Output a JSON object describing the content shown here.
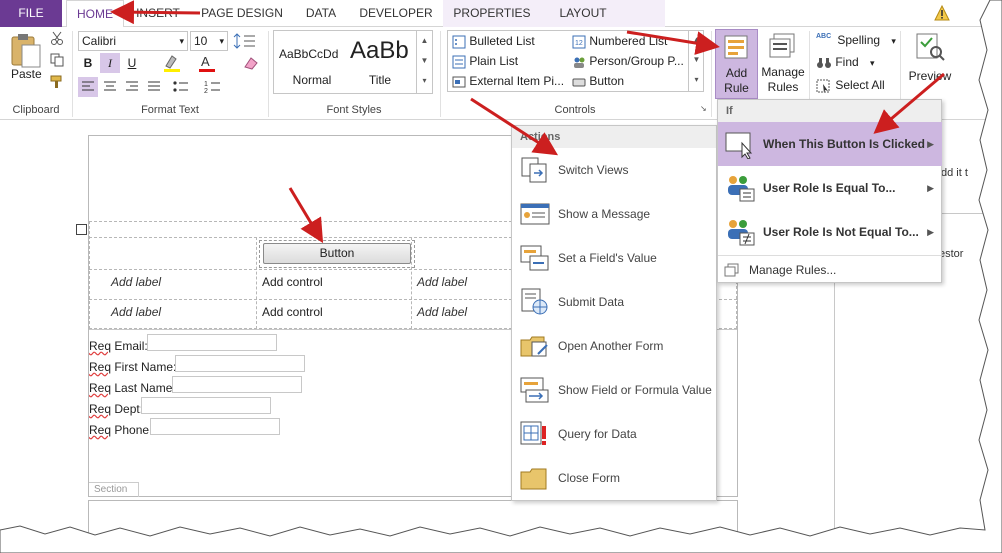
{
  "tabs": {
    "file": "FILE",
    "home": "HOME",
    "insert": "INSERT",
    "page_design": "PAGE DESIGN",
    "data": "DATA",
    "developer": "DEVELOPER",
    "properties": "PROPERTIES",
    "layout": "LAYOUT"
  },
  "clipboard": {
    "paste": "Paste",
    "group_label": "Clipboard"
  },
  "format_text": {
    "font_name": "Calibri",
    "font_size": "10",
    "bold": "B",
    "italic": "I",
    "underline": "U",
    "group_label": "Format Text"
  },
  "font_styles": {
    "normal_sample": "AaBbCcDd",
    "normal_name": "Normal",
    "title_sample": "AaBb",
    "title_name": "Title",
    "group_label": "Font Styles"
  },
  "controls": {
    "bulleted_list": "Bulleted List",
    "plain_list": "Plain List",
    "external_item_picker": "External Item Pi...",
    "numbered_list": "Numbered List",
    "person_group_picker": "Person/Group P...",
    "button": "Button",
    "group_label": "Controls"
  },
  "rules": {
    "add_rule_line1": "Add",
    "add_rule_line2": "Rule",
    "manage_rules_line1": "Manage",
    "manage_rules_line2": "Rules"
  },
  "editing": {
    "spelling": "Spelling",
    "find": "Find",
    "select_all": "Select All",
    "abc": "ABC"
  },
  "preview": "Preview",
  "form": {
    "button_label": "Button",
    "add_label": "Add label",
    "add_control": "Add control",
    "section_label": "Section",
    "fields": [
      {
        "prefix": "Req",
        "rest": " Email:"
      },
      {
        "prefix": "Req",
        "rest": " First Name:"
      },
      {
        "prefix": "Req",
        "rest": " Last Name:"
      },
      {
        "prefix": "Req",
        "rest": " Dept:"
      },
      {
        "prefix": "Req",
        "rest": " Phone:"
      }
    ]
  },
  "actions_menu": {
    "header": "Actions",
    "items": [
      "Switch Views",
      "Show a Message",
      "Set a Field's Value",
      "Submit Data",
      "Open Another Form",
      "Show Field or Formula Value",
      "Query for Data",
      "Close Form"
    ]
  },
  "if_menu": {
    "header": "If",
    "items": [
      "When This Button Is Clicked",
      "User Role Is Equal To...",
      "User Role Is Not Equal To..."
    ],
    "manage_rules": "Manage Rules..."
  },
  "right_pane": {
    "snippet1": "dd it t",
    "snippet2": "estor"
  },
  "colors": {
    "file_tab": "#6b3a93",
    "accent": "#6b3a93",
    "selected_highlight": "#cdb7e0",
    "arrow": "#cc1f1f"
  }
}
